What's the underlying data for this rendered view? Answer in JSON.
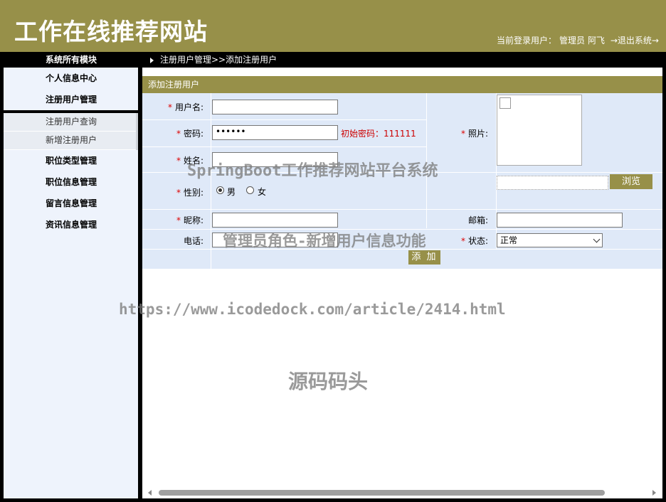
{
  "header": {
    "site_title": "工作在线推荐网站",
    "current_user_label": "当前登录用户：",
    "user_role": "管理员",
    "user_name": "阿飞",
    "logout_label": "→退出系统→"
  },
  "topbar": {
    "modules_title": "系统所有模块",
    "breadcrumb": "注册用户管理>>添加注册用户"
  },
  "sidebar": {
    "groups": [
      {
        "label": "个人信息中心"
      },
      {
        "label": "注册用户管理"
      },
      {
        "label": "职位类型管理"
      },
      {
        "label": "职位信息管理"
      },
      {
        "label": "留言信息管理"
      },
      {
        "label": "资讯信息管理"
      }
    ],
    "sub_items": [
      {
        "label": "注册用户查询"
      },
      {
        "label": "新增注册用户"
      }
    ]
  },
  "form": {
    "section_title": "添加注册用户",
    "required_mark": "*",
    "username_label": "用户名:",
    "username_value": "",
    "password_label": "密码:",
    "password_value": "••••••",
    "password_hint": "初始密码：111111",
    "name_label": "姓名:",
    "name_value": "",
    "gender_label": "性别:",
    "gender_male": "男",
    "gender_female": "女",
    "photo_label": "照片:",
    "browse_label": "浏览",
    "nickname_label": "昵称:",
    "nickname_value": "",
    "email_label": "邮箱:",
    "email_value": "",
    "phone_label": "电话:",
    "phone_value": "",
    "status_label": "状态:",
    "status_value": "正常",
    "submit_label": "添 加"
  },
  "watermarks": {
    "system_name": "SpringBoot工作推荐网站平台系统",
    "feature": "管理员角色-新增用户信息功能",
    "url": "https://www.icodedock.com/article/2414.html",
    "brand": "源码码头"
  },
  "colors": {
    "brand_olive": "#979049",
    "form_bg": "#dfe9f8",
    "sidebar_bg": "#eef3fc",
    "hint_red": "#cc0000"
  }
}
